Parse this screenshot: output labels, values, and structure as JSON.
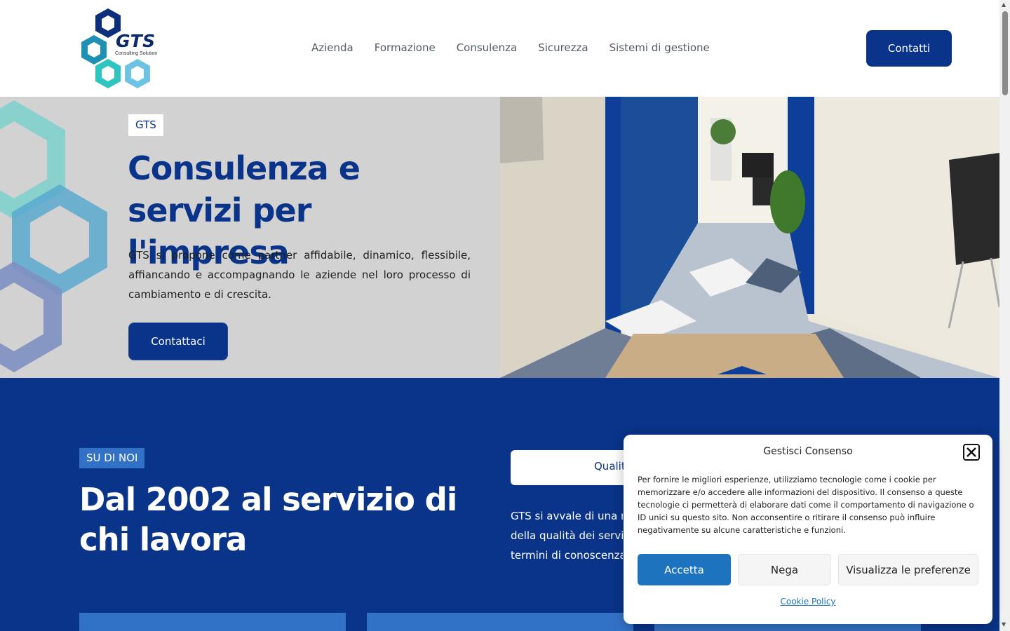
{
  "header": {
    "logo_text": "GTS",
    "logo_tagline": "Consulting Solution",
    "nav": [
      "Azienda",
      "Formazione",
      "Consulenza",
      "Sicurezza",
      "Sistemi di gestione"
    ],
    "cta_label": "Contatti"
  },
  "hero": {
    "badge": "GTS",
    "title": "Consulenza e servizi per l'impresa",
    "description": "GTS si propone come partner affidabile, dinamico, flessibile, affiancando e accompagnando le aziende nel loro processo di cambiamento e di crescita.",
    "button_label": "Contattaci"
  },
  "about": {
    "badge": "SU DI NOI",
    "title": "Dal 2002 al servizio di chi lavora",
    "tab_label": "Qualit",
    "text_lines": [
      "GTS si avvale di una re",
      "della qualità dei serviz",
      "termini di conoscenza"
    ]
  },
  "cookie": {
    "title": "Gestisci Consenso",
    "text": "Per fornire le migliori esperienze, utilizziamo tecnologie come i cookie per memorizzare e/o accedere alle informazioni del dispositivo. Il consenso a queste tecnologie ci permetterà di elaborare dati come il comportamento di navigazione o ID unici su questo sito. Non acconsentire o ritirare il consenso può influire negativamente su alcune caratteristiche e funzioni.",
    "accept_label": "Accetta",
    "deny_label": "Nega",
    "prefs_label": "Visualizza le preferenze",
    "policy_link": "Cookie Policy"
  },
  "colors": {
    "brand_blue": "#0a3489",
    "accent_blue": "#3272c6",
    "hero_gray": "#d2d2d2",
    "cookie_accept": "#1e73be"
  },
  "icons": [
    "gts-logo-icon",
    "hexagon-decoration-icon",
    "close-icon",
    "scroll-up-arrow-icon",
    "scroll-down-arrow-icon"
  ]
}
